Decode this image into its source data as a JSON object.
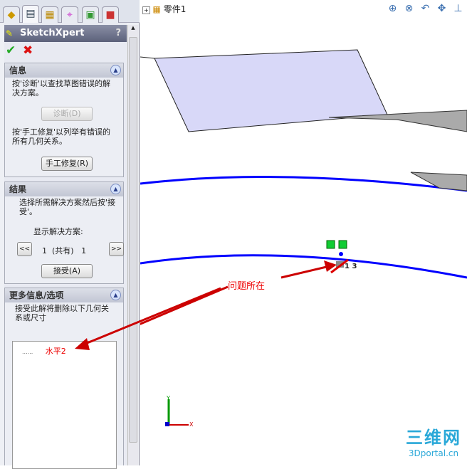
{
  "panel": {
    "title": "SketchXpert",
    "help": "?",
    "info": {
      "header": "信息",
      "text1": "按'诊断'以查找草图错误的解决方案。",
      "diagnose": "诊断(D)",
      "text2": "按'手工修复'以列举有错误的所有几何关系。",
      "manual_repair": "手工修复(R)"
    },
    "results": {
      "header": "结果",
      "text": "选择所需解决方案然后按'接受'。",
      "show_label": "显示解决方案:",
      "prev": "<<",
      "next": ">>",
      "current": "1",
      "of_label": "(共有)",
      "total": "1",
      "accept": "接受(A)"
    },
    "more": {
      "header": "更多信息/选项",
      "text": "接受此解将删除以下几何关系或尺寸",
      "list": [
        {
          "prefix": "......",
          "label": "水平2"
        }
      ]
    }
  },
  "viewport": {
    "tree_label": "零件1",
    "annotation": "问题所在",
    "dim_label": "1 3",
    "axis_x": "X",
    "axis_y": "Y",
    "watermark": "三维网",
    "watermark_url": "3Dportal.cn"
  },
  "colors": {
    "sketch": "#0000ff",
    "arrow": "#c00000",
    "plane": "#d8d8f8"
  }
}
